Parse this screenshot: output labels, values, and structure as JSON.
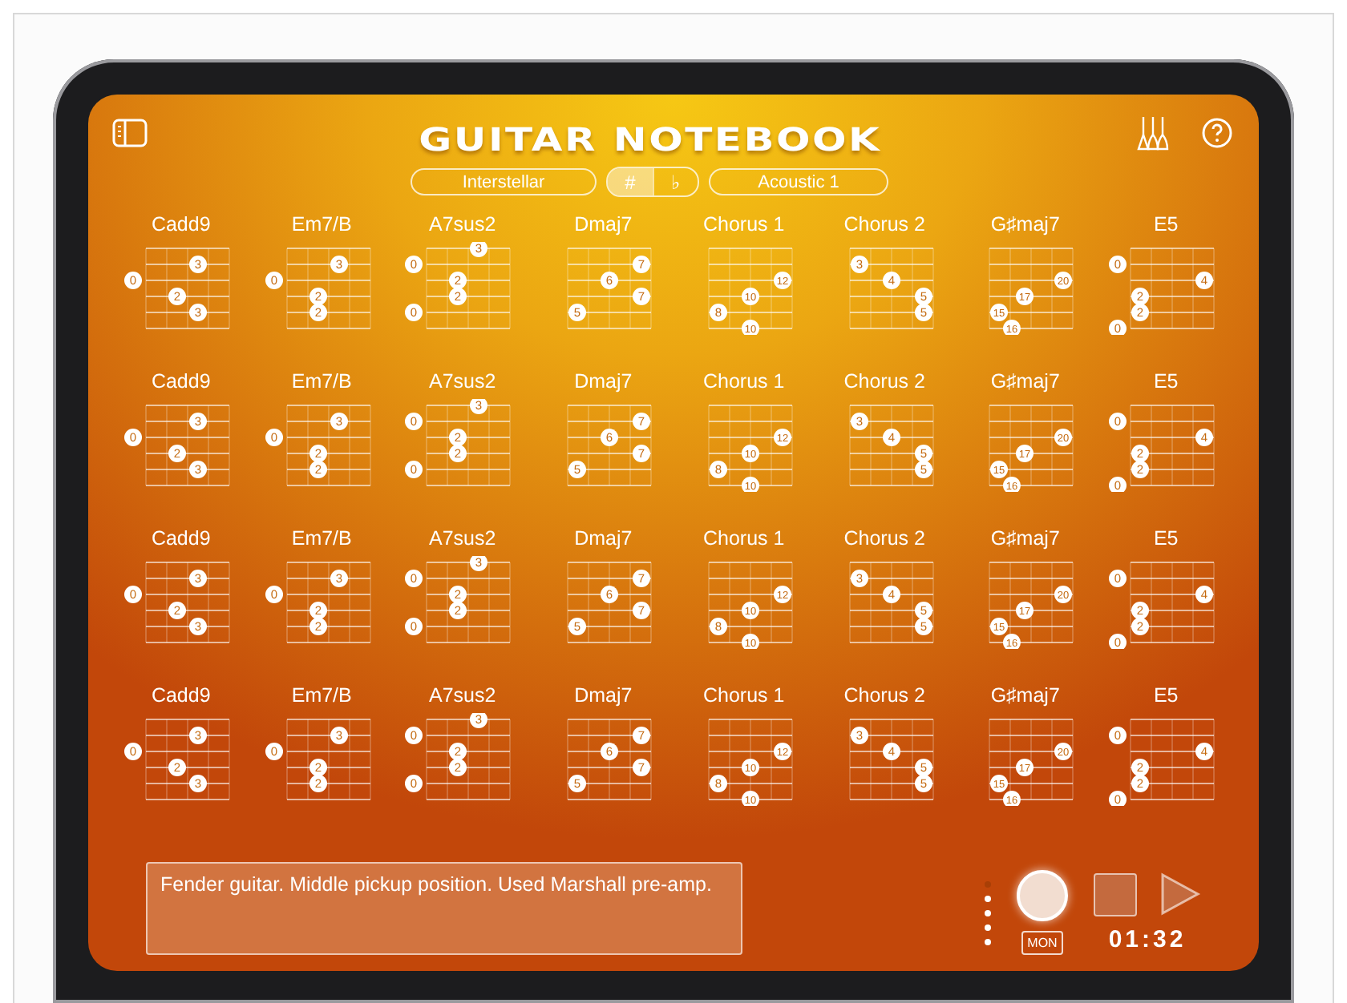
{
  "header": {
    "title": "GUITAR NOTEBOOK",
    "song": "Interstellar",
    "accidentals": [
      {
        "label": "#",
        "selected": true
      },
      {
        "label": "♭",
        "selected": false
      }
    ],
    "instrument": "Acoustic 1"
  },
  "chord_rows": [
    [
      {
        "name": "Cadd9",
        "strings": [
          {
            "kind": "unused"
          },
          {
            "kind": "fretted",
            "fret": "3"
          },
          {
            "kind": "open",
            "fret": "0"
          },
          {
            "kind": "fretted",
            "fret": "2"
          },
          {
            "kind": "fretted",
            "fret": "3"
          },
          {
            "kind": "unused"
          }
        ]
      },
      {
        "name": "Em7/B",
        "strings": [
          {
            "kind": "unused"
          },
          {
            "kind": "fretted",
            "fret": "3"
          },
          {
            "kind": "open",
            "fret": "0"
          },
          {
            "kind": "fretted",
            "fret": "2"
          },
          {
            "kind": "fretted",
            "fret": "2"
          },
          {
            "kind": "unused"
          }
        ]
      },
      {
        "name": "A7sus2",
        "strings": [
          {
            "kind": "fretted",
            "fret": "3"
          },
          {
            "kind": "open",
            "fret": "0"
          },
          {
            "kind": "fretted",
            "fret": "2"
          },
          {
            "kind": "fretted",
            "fret": "2"
          },
          {
            "kind": "open",
            "fret": "0"
          },
          {
            "kind": "unused"
          }
        ]
      },
      {
        "name": "Dmaj7",
        "strings": [
          {
            "kind": "unused"
          },
          {
            "kind": "fretted",
            "fret": "7"
          },
          {
            "kind": "fretted",
            "fret": "6"
          },
          {
            "kind": "fretted",
            "fret": "7"
          },
          {
            "kind": "fretted",
            "fret": "5"
          },
          {
            "kind": "unused"
          }
        ]
      },
      {
        "name": "Chorus 1",
        "strings": [
          {
            "kind": "unused"
          },
          {
            "kind": "unused"
          },
          {
            "kind": "fretted",
            "fret": "12"
          },
          {
            "kind": "fretted",
            "fret": "10"
          },
          {
            "kind": "fretted",
            "fret": "8"
          },
          {
            "kind": "fretted",
            "fret": "10"
          }
        ]
      },
      {
        "name": "Chorus 2",
        "strings": [
          {
            "kind": "unused"
          },
          {
            "kind": "fretted",
            "fret": "3"
          },
          {
            "kind": "fretted",
            "fret": "4"
          },
          {
            "kind": "fretted",
            "fret": "5"
          },
          {
            "kind": "fretted",
            "fret": "5"
          },
          {
            "kind": "unused"
          }
        ]
      },
      {
        "name": "G♯maj7",
        "strings": [
          {
            "kind": "unused"
          },
          {
            "kind": "unused"
          },
          {
            "kind": "fretted",
            "fret": "20"
          },
          {
            "kind": "fretted",
            "fret": "17"
          },
          {
            "kind": "fretted",
            "fret": "15"
          },
          {
            "kind": "fretted",
            "fret": "16"
          }
        ]
      },
      {
        "name": "E5",
        "strings": [
          {
            "kind": "unused"
          },
          {
            "kind": "open",
            "fret": "0"
          },
          {
            "kind": "fretted",
            "fret": "4"
          },
          {
            "kind": "fretted",
            "fret": "2"
          },
          {
            "kind": "fretted",
            "fret": "2"
          },
          {
            "kind": "open",
            "fret": "0"
          }
        ]
      }
    ],
    [
      {
        "name": "Cadd9",
        "strings": [
          {
            "kind": "unused"
          },
          {
            "kind": "fretted",
            "fret": "3"
          },
          {
            "kind": "open",
            "fret": "0"
          },
          {
            "kind": "fretted",
            "fret": "2"
          },
          {
            "kind": "fretted",
            "fret": "3"
          },
          {
            "kind": "unused"
          }
        ]
      },
      {
        "name": "Em7/B",
        "strings": [
          {
            "kind": "unused"
          },
          {
            "kind": "fretted",
            "fret": "3"
          },
          {
            "kind": "open",
            "fret": "0"
          },
          {
            "kind": "fretted",
            "fret": "2"
          },
          {
            "kind": "fretted",
            "fret": "2"
          },
          {
            "kind": "unused"
          }
        ]
      },
      {
        "name": "A7sus2",
        "strings": [
          {
            "kind": "fretted",
            "fret": "3"
          },
          {
            "kind": "open",
            "fret": "0"
          },
          {
            "kind": "fretted",
            "fret": "2"
          },
          {
            "kind": "fretted",
            "fret": "2"
          },
          {
            "kind": "open",
            "fret": "0"
          },
          {
            "kind": "unused"
          }
        ]
      },
      {
        "name": "Dmaj7",
        "strings": [
          {
            "kind": "unused"
          },
          {
            "kind": "fretted",
            "fret": "7"
          },
          {
            "kind": "fretted",
            "fret": "6"
          },
          {
            "kind": "fretted",
            "fret": "7"
          },
          {
            "kind": "fretted",
            "fret": "5"
          },
          {
            "kind": "unused"
          }
        ]
      },
      {
        "name": "Chorus 1",
        "strings": [
          {
            "kind": "unused"
          },
          {
            "kind": "unused"
          },
          {
            "kind": "fretted",
            "fret": "12"
          },
          {
            "kind": "fretted",
            "fret": "10"
          },
          {
            "kind": "fretted",
            "fret": "8"
          },
          {
            "kind": "fretted",
            "fret": "10"
          }
        ]
      },
      {
        "name": "Chorus 2",
        "strings": [
          {
            "kind": "unused"
          },
          {
            "kind": "fretted",
            "fret": "3"
          },
          {
            "kind": "fretted",
            "fret": "4"
          },
          {
            "kind": "fretted",
            "fret": "5"
          },
          {
            "kind": "fretted",
            "fret": "5"
          },
          {
            "kind": "unused"
          }
        ]
      },
      {
        "name": "G♯maj7",
        "strings": [
          {
            "kind": "unused"
          },
          {
            "kind": "unused"
          },
          {
            "kind": "fretted",
            "fret": "20"
          },
          {
            "kind": "fretted",
            "fret": "17"
          },
          {
            "kind": "fretted",
            "fret": "15"
          },
          {
            "kind": "fretted",
            "fret": "16"
          }
        ]
      },
      {
        "name": "E5",
        "strings": [
          {
            "kind": "unused"
          },
          {
            "kind": "open",
            "fret": "0"
          },
          {
            "kind": "fretted",
            "fret": "4"
          },
          {
            "kind": "fretted",
            "fret": "2"
          },
          {
            "kind": "fretted",
            "fret": "2"
          },
          {
            "kind": "open",
            "fret": "0"
          }
        ]
      }
    ],
    [
      {
        "name": "Cadd9",
        "strings": [
          {
            "kind": "unused"
          },
          {
            "kind": "fretted",
            "fret": "3"
          },
          {
            "kind": "open",
            "fret": "0"
          },
          {
            "kind": "fretted",
            "fret": "2"
          },
          {
            "kind": "fretted",
            "fret": "3"
          },
          {
            "kind": "unused"
          }
        ]
      },
      {
        "name": "Em7/B",
        "strings": [
          {
            "kind": "unused"
          },
          {
            "kind": "fretted",
            "fret": "3"
          },
          {
            "kind": "open",
            "fret": "0"
          },
          {
            "kind": "fretted",
            "fret": "2"
          },
          {
            "kind": "fretted",
            "fret": "2"
          },
          {
            "kind": "unused"
          }
        ]
      },
      {
        "name": "A7sus2",
        "strings": [
          {
            "kind": "fretted",
            "fret": "3"
          },
          {
            "kind": "open",
            "fret": "0"
          },
          {
            "kind": "fretted",
            "fret": "2"
          },
          {
            "kind": "fretted",
            "fret": "2"
          },
          {
            "kind": "open",
            "fret": "0"
          },
          {
            "kind": "unused"
          }
        ]
      },
      {
        "name": "Dmaj7",
        "strings": [
          {
            "kind": "unused"
          },
          {
            "kind": "fretted",
            "fret": "7"
          },
          {
            "kind": "fretted",
            "fret": "6"
          },
          {
            "kind": "fretted",
            "fret": "7"
          },
          {
            "kind": "fretted",
            "fret": "5"
          },
          {
            "kind": "unused"
          }
        ]
      },
      {
        "name": "Chorus 1",
        "strings": [
          {
            "kind": "unused"
          },
          {
            "kind": "unused"
          },
          {
            "kind": "fretted",
            "fret": "12"
          },
          {
            "kind": "fretted",
            "fret": "10"
          },
          {
            "kind": "fretted",
            "fret": "8"
          },
          {
            "kind": "fretted",
            "fret": "10"
          }
        ]
      },
      {
        "name": "Chorus 2",
        "strings": [
          {
            "kind": "unused"
          },
          {
            "kind": "fretted",
            "fret": "3"
          },
          {
            "kind": "fretted",
            "fret": "4"
          },
          {
            "kind": "fretted",
            "fret": "5"
          },
          {
            "kind": "fretted",
            "fret": "5"
          },
          {
            "kind": "unused"
          }
        ]
      },
      {
        "name": "G♯maj7",
        "strings": [
          {
            "kind": "unused"
          },
          {
            "kind": "unused"
          },
          {
            "kind": "fretted",
            "fret": "20"
          },
          {
            "kind": "fretted",
            "fret": "17"
          },
          {
            "kind": "fretted",
            "fret": "15"
          },
          {
            "kind": "fretted",
            "fret": "16"
          }
        ]
      },
      {
        "name": "E5",
        "strings": [
          {
            "kind": "unused"
          },
          {
            "kind": "open",
            "fret": "0"
          },
          {
            "kind": "fretted",
            "fret": "4"
          },
          {
            "kind": "fretted",
            "fret": "2"
          },
          {
            "kind": "fretted",
            "fret": "2"
          },
          {
            "kind": "open",
            "fret": "0"
          }
        ]
      }
    ],
    [
      {
        "name": "Cadd9",
        "strings": [
          {
            "kind": "unused"
          },
          {
            "kind": "fretted",
            "fret": "3"
          },
          {
            "kind": "open",
            "fret": "0"
          },
          {
            "kind": "fretted",
            "fret": "2"
          },
          {
            "kind": "fretted",
            "fret": "3"
          },
          {
            "kind": "unused"
          }
        ]
      },
      {
        "name": "Em7/B",
        "strings": [
          {
            "kind": "unused"
          },
          {
            "kind": "fretted",
            "fret": "3"
          },
          {
            "kind": "open",
            "fret": "0"
          },
          {
            "kind": "fretted",
            "fret": "2"
          },
          {
            "kind": "fretted",
            "fret": "2"
          },
          {
            "kind": "unused"
          }
        ]
      },
      {
        "name": "A7sus2",
        "strings": [
          {
            "kind": "fretted",
            "fret": "3"
          },
          {
            "kind": "open",
            "fret": "0"
          },
          {
            "kind": "fretted",
            "fret": "2"
          },
          {
            "kind": "fretted",
            "fret": "2"
          },
          {
            "kind": "open",
            "fret": "0"
          },
          {
            "kind": "unused"
          }
        ]
      },
      {
        "name": "Dmaj7",
        "strings": [
          {
            "kind": "unused"
          },
          {
            "kind": "fretted",
            "fret": "7"
          },
          {
            "kind": "fretted",
            "fret": "6"
          },
          {
            "kind": "fretted",
            "fret": "7"
          },
          {
            "kind": "fretted",
            "fret": "5"
          },
          {
            "kind": "unused"
          }
        ]
      },
      {
        "name": "Chorus 1",
        "strings": [
          {
            "kind": "unused"
          },
          {
            "kind": "unused"
          },
          {
            "kind": "fretted",
            "fret": "12"
          },
          {
            "kind": "fretted",
            "fret": "10"
          },
          {
            "kind": "fretted",
            "fret": "8"
          },
          {
            "kind": "fretted",
            "fret": "10"
          }
        ]
      },
      {
        "name": "Chorus 2",
        "strings": [
          {
            "kind": "unused"
          },
          {
            "kind": "fretted",
            "fret": "3"
          },
          {
            "kind": "fretted",
            "fret": "4"
          },
          {
            "kind": "fretted",
            "fret": "5"
          },
          {
            "kind": "fretted",
            "fret": "5"
          },
          {
            "kind": "unused"
          }
        ]
      },
      {
        "name": "G♯maj7",
        "strings": [
          {
            "kind": "unused"
          },
          {
            "kind": "unused"
          },
          {
            "kind": "fretted",
            "fret": "20"
          },
          {
            "kind": "fretted",
            "fret": "17"
          },
          {
            "kind": "fretted",
            "fret": "15"
          },
          {
            "kind": "fretted",
            "fret": "16"
          }
        ]
      },
      {
        "name": "E5",
        "strings": [
          {
            "kind": "unused"
          },
          {
            "kind": "open",
            "fret": "0"
          },
          {
            "kind": "fretted",
            "fret": "4"
          },
          {
            "kind": "fretted",
            "fret": "2"
          },
          {
            "kind": "fretted",
            "fret": "2"
          },
          {
            "kind": "open",
            "fret": "0"
          }
        ]
      }
    ]
  ],
  "notes": "Fender guitar. Middle pickup position. Used Marshall pre-amp.",
  "recorder": {
    "monitor": "MON",
    "time": "01:32"
  }
}
